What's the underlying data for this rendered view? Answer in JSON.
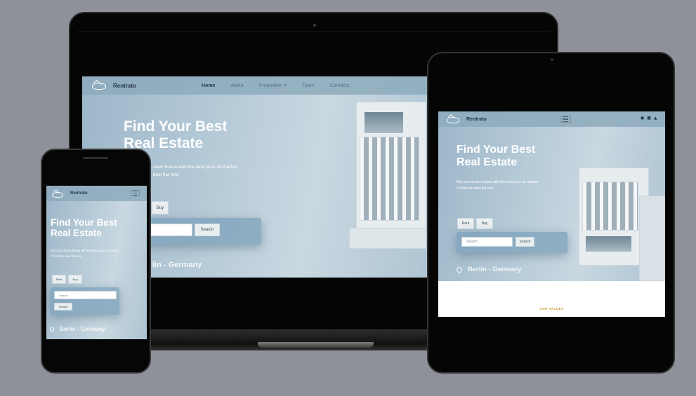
{
  "site": {
    "brand": "Rentrato",
    "hero_title_line1": "Find Your Best",
    "hero_title_line2": "Real Estate",
    "hero_sub_line1": "Buy your dream house with the best price on market,",
    "hero_sub_line2": "Or find the best flat rent.",
    "rent_label": "Rent",
    "buy_label": "Buy",
    "search_placeholder": "Search",
    "search_button": "Search",
    "city": "Berlin - Germany",
    "values_heading": "OUR VALUES"
  },
  "laptop": {
    "nav_items": [
      {
        "label": "Home"
      },
      {
        "label": "About"
      },
      {
        "label": "Properties"
      },
      {
        "label": "Team"
      },
      {
        "label": "Contacts"
      }
    ],
    "hero_sub_line1_fragment": "ream house with the best price on market,",
    "hero_sub_line2_fragment": "best flat rent.",
    "buy_label": "Buy",
    "search_button": "Search",
    "city_fragment": "lin - Germany"
  },
  "colors": {
    "page_bg": "#8e9199",
    "hero_blue": "#9db7c9",
    "accent_gold": "#c99a1e",
    "nav_text": "#2b3b47"
  },
  "icons": [
    "logo-icon",
    "hamburger-icon",
    "user-icon",
    "cart-icon",
    "location-pin-icon",
    "chevron-down-icon"
  ]
}
